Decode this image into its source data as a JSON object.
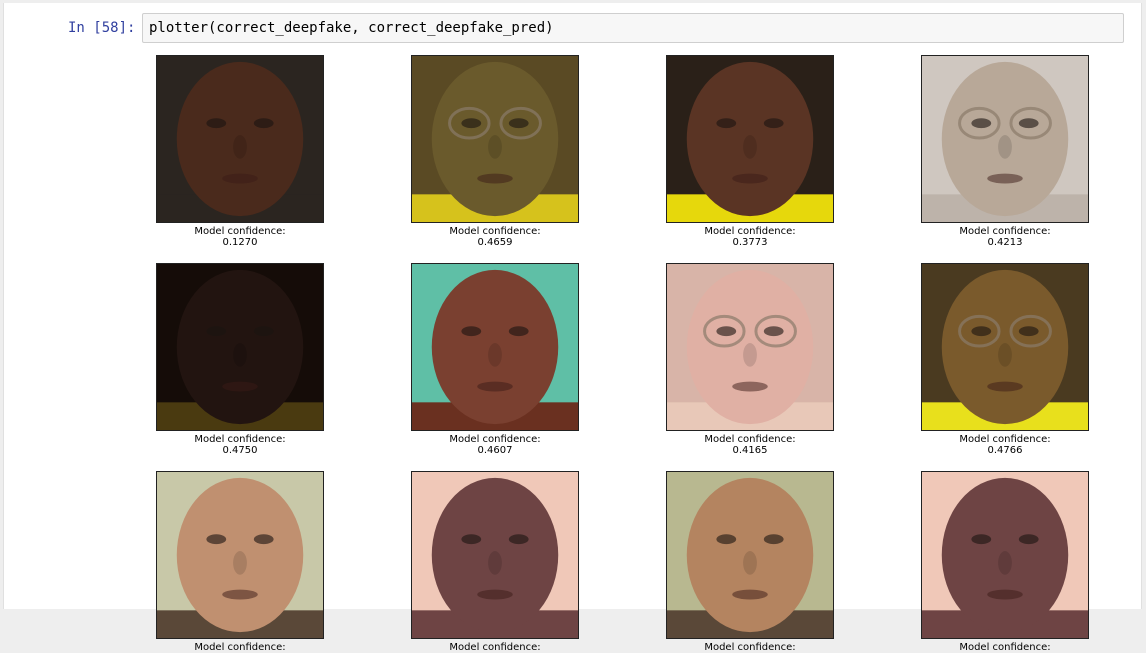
{
  "cell": {
    "prompt": "In [58]:",
    "code": "plotter(correct_deepfake, correct_deepfake_pred)"
  },
  "images": [
    {
      "label": "Model confidence:",
      "value": "0.1270",
      "skin": "#4a2a1c",
      "bg": "#2b2520",
      "shirt": "#2b2520",
      "glasses": false
    },
    {
      "label": "Model confidence:",
      "value": "0.4659",
      "skin": "#6a5a2c",
      "bg": "#5a4a24",
      "shirt": "#d6c21c",
      "glasses": true
    },
    {
      "label": "Model confidence:",
      "value": "0.3773",
      "skin": "#5a3424",
      "bg": "#2a2018",
      "shirt": "#e6d80c",
      "glasses": false
    },
    {
      "label": "Model confidence:",
      "value": "0.4213",
      "skin": "#b8a898",
      "bg": "#cfc7c0",
      "shirt": "#bdb3aa",
      "glasses": true
    },
    {
      "label": "Model confidence:",
      "value": "0.4750",
      "skin": "#221410",
      "bg": "#150c08",
      "shirt": "#4a3a10",
      "glasses": false
    },
    {
      "label": "Model confidence:",
      "value": "0.4607",
      "skin": "#7a4030",
      "bg": "#5fbfa6",
      "shirt": "#6a3020",
      "glasses": false
    },
    {
      "label": "Model confidence:",
      "value": "0.4165",
      "skin": "#e0b0a4",
      "bg": "#d8b4a8",
      "shirt": "#e8c8b8",
      "glasses": true
    },
    {
      "label": "Model confidence:",
      "value": "0.4766",
      "skin": "#7a5a2c",
      "bg": "#4a3a20",
      "shirt": "#e8e01c",
      "glasses": true
    },
    {
      "label": "Model confidence:",
      "value": "",
      "skin": "#c09070",
      "bg": "#c8c8a8",
      "shirt": "#5a4838",
      "glasses": false
    },
    {
      "label": "Model confidence:",
      "value": "",
      "skin": "#6e4444",
      "bg": "#f0c8b8",
      "shirt": "#6e4444",
      "glasses": false
    },
    {
      "label": "Model confidence:",
      "value": "",
      "skin": "#b48460",
      "bg": "#b8b890",
      "shirt": "#5a4838",
      "glasses": false
    },
    {
      "label": "Model confidence:",
      "value": "",
      "skin": "#6e4444",
      "bg": "#f0c8b8",
      "shirt": "#6e4444",
      "glasses": false
    }
  ]
}
